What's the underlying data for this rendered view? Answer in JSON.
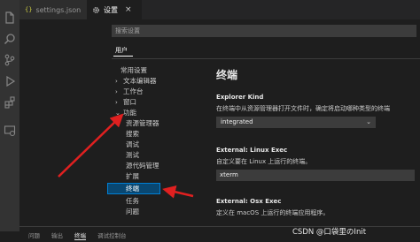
{
  "activity_bar": {
    "icons": [
      "files-icon",
      "search-icon",
      "source-control-icon",
      "run-debug-icon",
      "extensions-icon",
      "remote-explorer-icon"
    ]
  },
  "tabs": [
    {
      "label": "settings.json",
      "icon": "json-file-icon",
      "active": false
    },
    {
      "label": "设置",
      "icon": "gear-icon",
      "active": true,
      "close": "×"
    }
  ],
  "search": {
    "placeholder": "搜索设置"
  },
  "scope_tabs": [
    {
      "label": "用户",
      "active": true
    }
  ],
  "toc": [
    {
      "label": "常用设置",
      "chevron": ""
    },
    {
      "label": "文本编辑器",
      "chevron": "›"
    },
    {
      "label": "工作台",
      "chevron": "›"
    },
    {
      "label": "窗口",
      "chevron": "›"
    },
    {
      "label": "功能",
      "chevron": "⌄"
    },
    {
      "label": "资源管理器",
      "chevron": ""
    },
    {
      "label": "搜索",
      "chevron": ""
    },
    {
      "label": "调试",
      "chevron": ""
    },
    {
      "label": "测试",
      "chevron": ""
    },
    {
      "label": "源代码管理",
      "chevron": ""
    },
    {
      "label": "扩展",
      "chevron": ""
    },
    {
      "label": "终端",
      "chevron": "",
      "selected": true
    },
    {
      "label": "任务",
      "chevron": ""
    },
    {
      "label": "问题",
      "chevron": ""
    }
  ],
  "settings": {
    "section_title": "终端",
    "explorer_kind": {
      "title": "Explorer Kind",
      "description": "在终端中从资源管理器打开文件时，确定将启动哪种类型的终端",
      "value": "integrated"
    },
    "linux_exec": {
      "title": "External: Linux Exec",
      "description": "自定义要在 Linux 上运行的终端。",
      "value": "xterm"
    },
    "osx_exec": {
      "title": "External: Osx Exec",
      "description": "定义在 macOS 上运行的终端应用程序。"
    }
  },
  "bottom_panel": {
    "tabs": [
      "问题",
      "输出",
      "终端",
      "调试控制台"
    ],
    "active": "终端"
  },
  "watermark": "CSDN @口袋里のInit",
  "colors": {
    "accent": "#007fd4",
    "selection": "#094771",
    "annotation_arrow": "#e02020",
    "json_icon": "#cbcb41"
  }
}
